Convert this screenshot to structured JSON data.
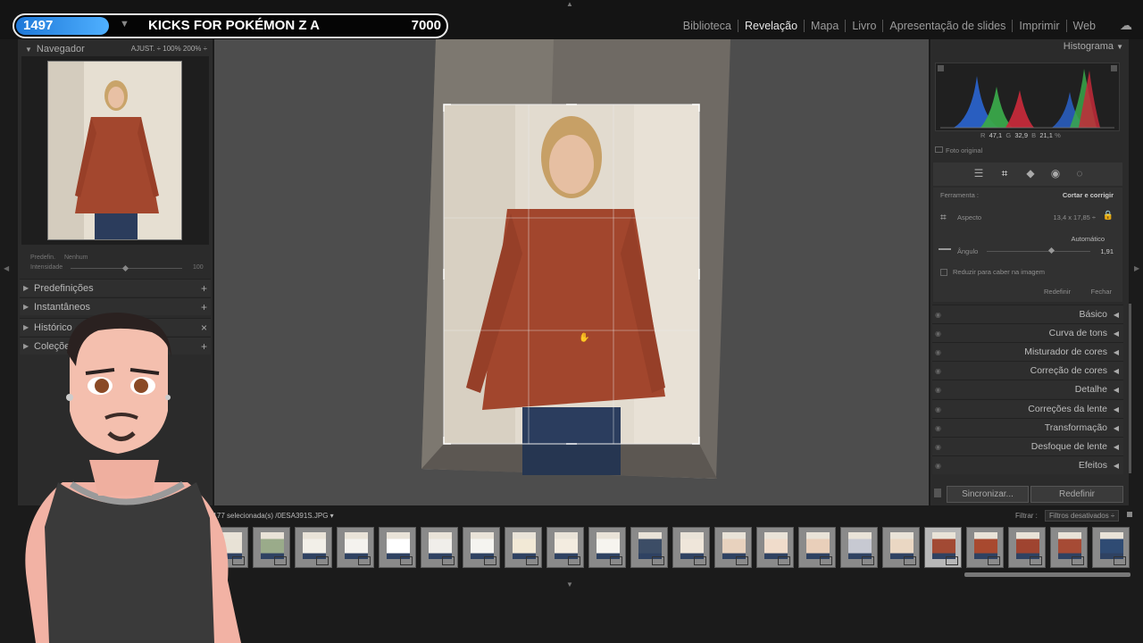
{
  "overlay": {
    "count": "1497",
    "arrow": "▼",
    "title": "KICKS FOR POKÉMON Z A",
    "points": "7000"
  },
  "modules": [
    {
      "label": "Biblioteca",
      "active": false
    },
    {
      "label": "Revelação",
      "active": true
    },
    {
      "label": "Mapa",
      "active": false
    },
    {
      "label": "Livro",
      "active": false
    },
    {
      "label": "Apresentação de slides",
      "active": false
    },
    {
      "label": "Imprimir",
      "active": false
    },
    {
      "label": "Web",
      "active": false
    }
  ],
  "navigator": {
    "title": "Navegador",
    "opts": "AJUST. ÷   100%   200% ÷"
  },
  "preset": {
    "label": "Predefin.",
    "value": "Nenhum",
    "intensity_label": "Intensidade",
    "intensity_value": "100"
  },
  "left_sections": [
    {
      "label": "Predefinições",
      "action": "+"
    },
    {
      "label": "Instantâneos",
      "action": "+"
    },
    {
      "label": "Histórico",
      "action": "×"
    },
    {
      "label": "Coleções",
      "action": "+"
    }
  ],
  "histogram": {
    "title": "Histograma",
    "r_label": "R",
    "r": "47,1",
    "g_label": "G",
    "g": "32,9",
    "b_label": "B",
    "b": "21,1",
    "unit": "%",
    "original": "Foto original"
  },
  "crop": {
    "tool_label": "Ferramenta :",
    "tool_value": "Cortar e corrigir",
    "aspect_label": "Aspecto",
    "aspect_value": "13,4 x 17,85 ÷",
    "auto_label": "Automático",
    "angle_label": "Ângulo",
    "angle_value": "1,91",
    "angle_level": 0.62,
    "constrain_label": "Reduzir para caber na imagem",
    "reset_label": "Redefinir",
    "close_label": "Fechar"
  },
  "right_sections": [
    "Básico",
    "Curva de tons",
    "Misturador de cores",
    "Correção de cores",
    "Detalhe",
    "Correções da lente",
    "Transformação",
    "Desfoque de lente",
    "Efeitos"
  ],
  "buttons": {
    "sync": "Sincronizar...",
    "reset": "Redefinir"
  },
  "filmstrip": {
    "info": "s /177 selecionada(s) /0ESA391S.JPG ▾",
    "filter_label": "Filtrar :",
    "filter_value": "Filtros desativados",
    "shirts": [
      "#e8e2d6",
      "#9aab8a",
      "#f2efe8",
      "#f4f2ee",
      "#ffffff",
      "#f0eeea",
      "#f5f4f0",
      "#f2e9d6",
      "#f3ece0",
      "#f6f4ef",
      "#3c4d66",
      "#efe6da",
      "#e8d2be",
      "#f0dccb",
      "#e9cfba",
      "#c7c9d2",
      "#ead7c3",
      "#a24a34",
      "#a8492f",
      "#9f4430",
      "#a64b35",
      "#2f4b73"
    ],
    "selected_index": 17
  }
}
